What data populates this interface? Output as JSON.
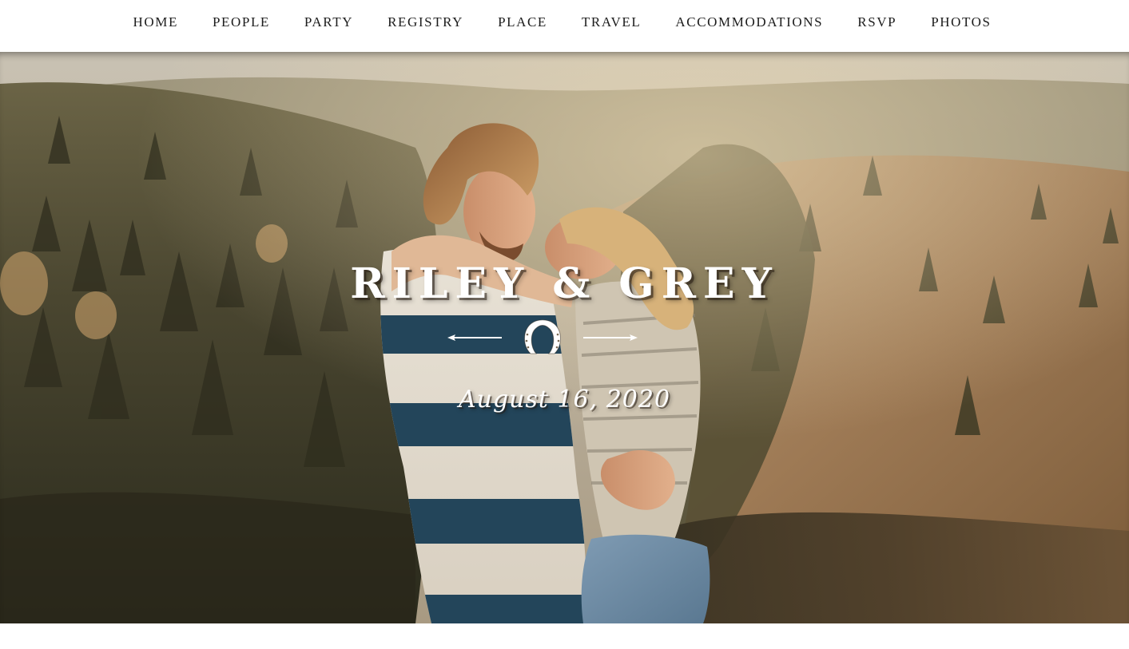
{
  "nav": {
    "items": [
      {
        "label": "HOME"
      },
      {
        "label": "PEOPLE"
      },
      {
        "label": "PARTY"
      },
      {
        "label": "REGISTRY"
      },
      {
        "label": "PLACE"
      },
      {
        "label": "TRAVEL"
      },
      {
        "label": "ACCOMMODATIONS"
      },
      {
        "label": "RSVP"
      },
      {
        "label": "PHOTOS"
      }
    ]
  },
  "hero": {
    "names": "RILEY & GREY",
    "ornament_icon": "horseshoe-icon",
    "date": "August 16, 2020"
  },
  "colors": {
    "nav_background": "#ffffff",
    "nav_text": "#1c1c1c",
    "hero_text": "#ffffff",
    "hill_warm": "#9e7a55",
    "forest_dark": "#3e3a26"
  }
}
